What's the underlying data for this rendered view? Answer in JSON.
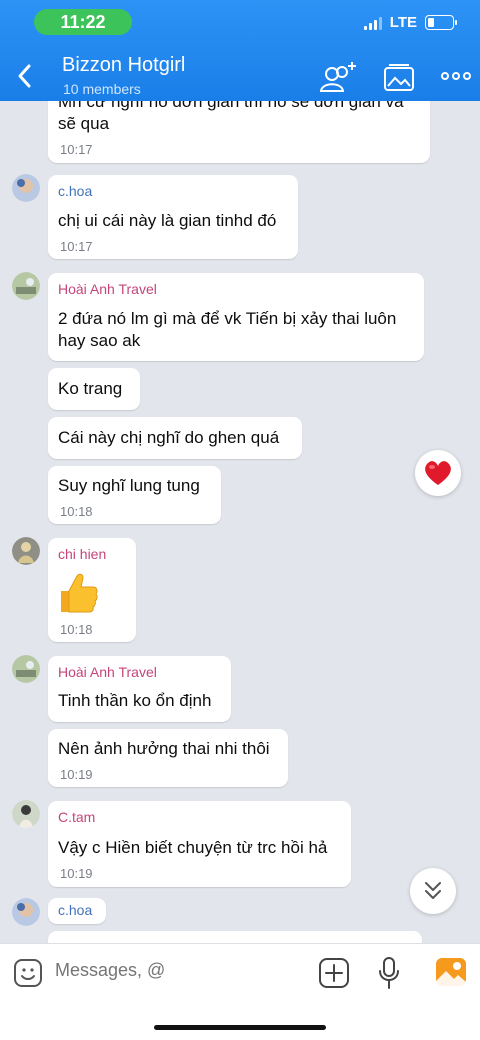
{
  "status": {
    "time": "11:22",
    "network": "LTE"
  },
  "header": {
    "title": "Bizzon Hotgirl",
    "subtitle": "10 members"
  },
  "messages": [
    {
      "text": "Mh cứ nghĩ nó đơn giản thì nó sẽ đơn giản và sẽ qua",
      "time": "10:17"
    },
    {
      "sender": "c.hoa",
      "text": "chị ui cái này là gian tinhd đó",
      "time": "10:17"
    },
    {
      "sender": "Hoài Anh Travel",
      "text": "2 đứa nó lm gì mà để vk Tiến bị xảy thai luôn hay sao ak"
    },
    {
      "text": "Ko trang"
    },
    {
      "text": "Cái này chị nghĩ do ghen quá"
    },
    {
      "text": "Suy nghĩ lung tung",
      "time": "10:18"
    },
    {
      "sender": "chi hien",
      "time": "10:18"
    },
    {
      "sender": "Hoài Anh Travel",
      "text": "Tinh thần ko ổn định"
    },
    {
      "text": "Nên ảnh hưởng thai nhi thôi",
      "time": "10:19"
    },
    {
      "sender": "C.tam",
      "text": "Vậy c Hiền biết chuyện từ trc hồi hả",
      "time": "10:19"
    },
    {
      "sender": "c.hoa"
    }
  ],
  "composer": {
    "placeholder": "Messages, @"
  },
  "colors": {
    "header": "#1a7ee8",
    "sender_pink": "#c5457a",
    "sender_blue": "#4472b8"
  },
  "icons": [
    "back-icon",
    "add-member-icon",
    "album-icon",
    "more-icon",
    "heart-icon",
    "scroll-down-icon",
    "sticker-icon",
    "add-icon",
    "mic-icon",
    "image-icon"
  ]
}
